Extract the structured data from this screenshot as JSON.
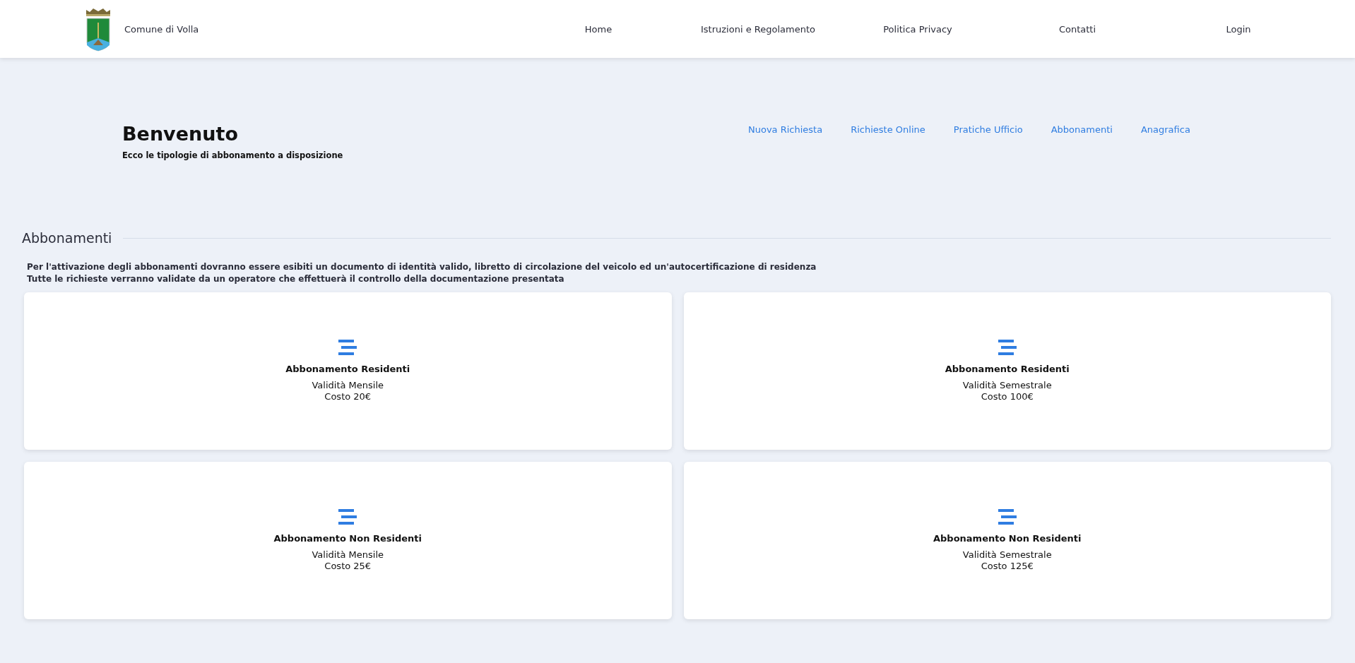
{
  "header": {
    "site_name": "Comune di Volla",
    "nav": [
      "Home",
      "Istruzioni e Regolamento",
      "Politica Privacy",
      "Contatti",
      "Login"
    ]
  },
  "hero": {
    "title": "Benvenuto",
    "subtitle": "Ecco le tipologie di abbonamento a disposizione",
    "links": [
      "Nuova Richiesta",
      "Richieste Online",
      "Pratiche Ufficio",
      "Abbonamenti",
      "Anagrafica"
    ]
  },
  "section": {
    "title": "Abbonamenti",
    "notes": [
      "Per l'attivazione degli abbonamenti dovranno essere esibiti un documento di identità valido, libretto di circolazione del veicolo ed un'autocertificazione di residenza",
      "Tutte le richieste verranno validate da un operatore che effettuerà il controllo della documentazione presentata"
    ]
  },
  "cards": [
    {
      "title": "Abbonamento Residenti",
      "validity": "Validità Mensile",
      "cost": "Costo 20€"
    },
    {
      "title": "Abbonamento Residenti",
      "validity": "Validità Semestrale",
      "cost": "Costo 100€"
    },
    {
      "title": "Abbonamento Non Residenti",
      "validity": "Validità Mensile",
      "cost": "Costo 25€"
    },
    {
      "title": "Abbonamento Non Residenti",
      "validity": "Validità Semestrale",
      "cost": "Costo 125€"
    }
  ]
}
